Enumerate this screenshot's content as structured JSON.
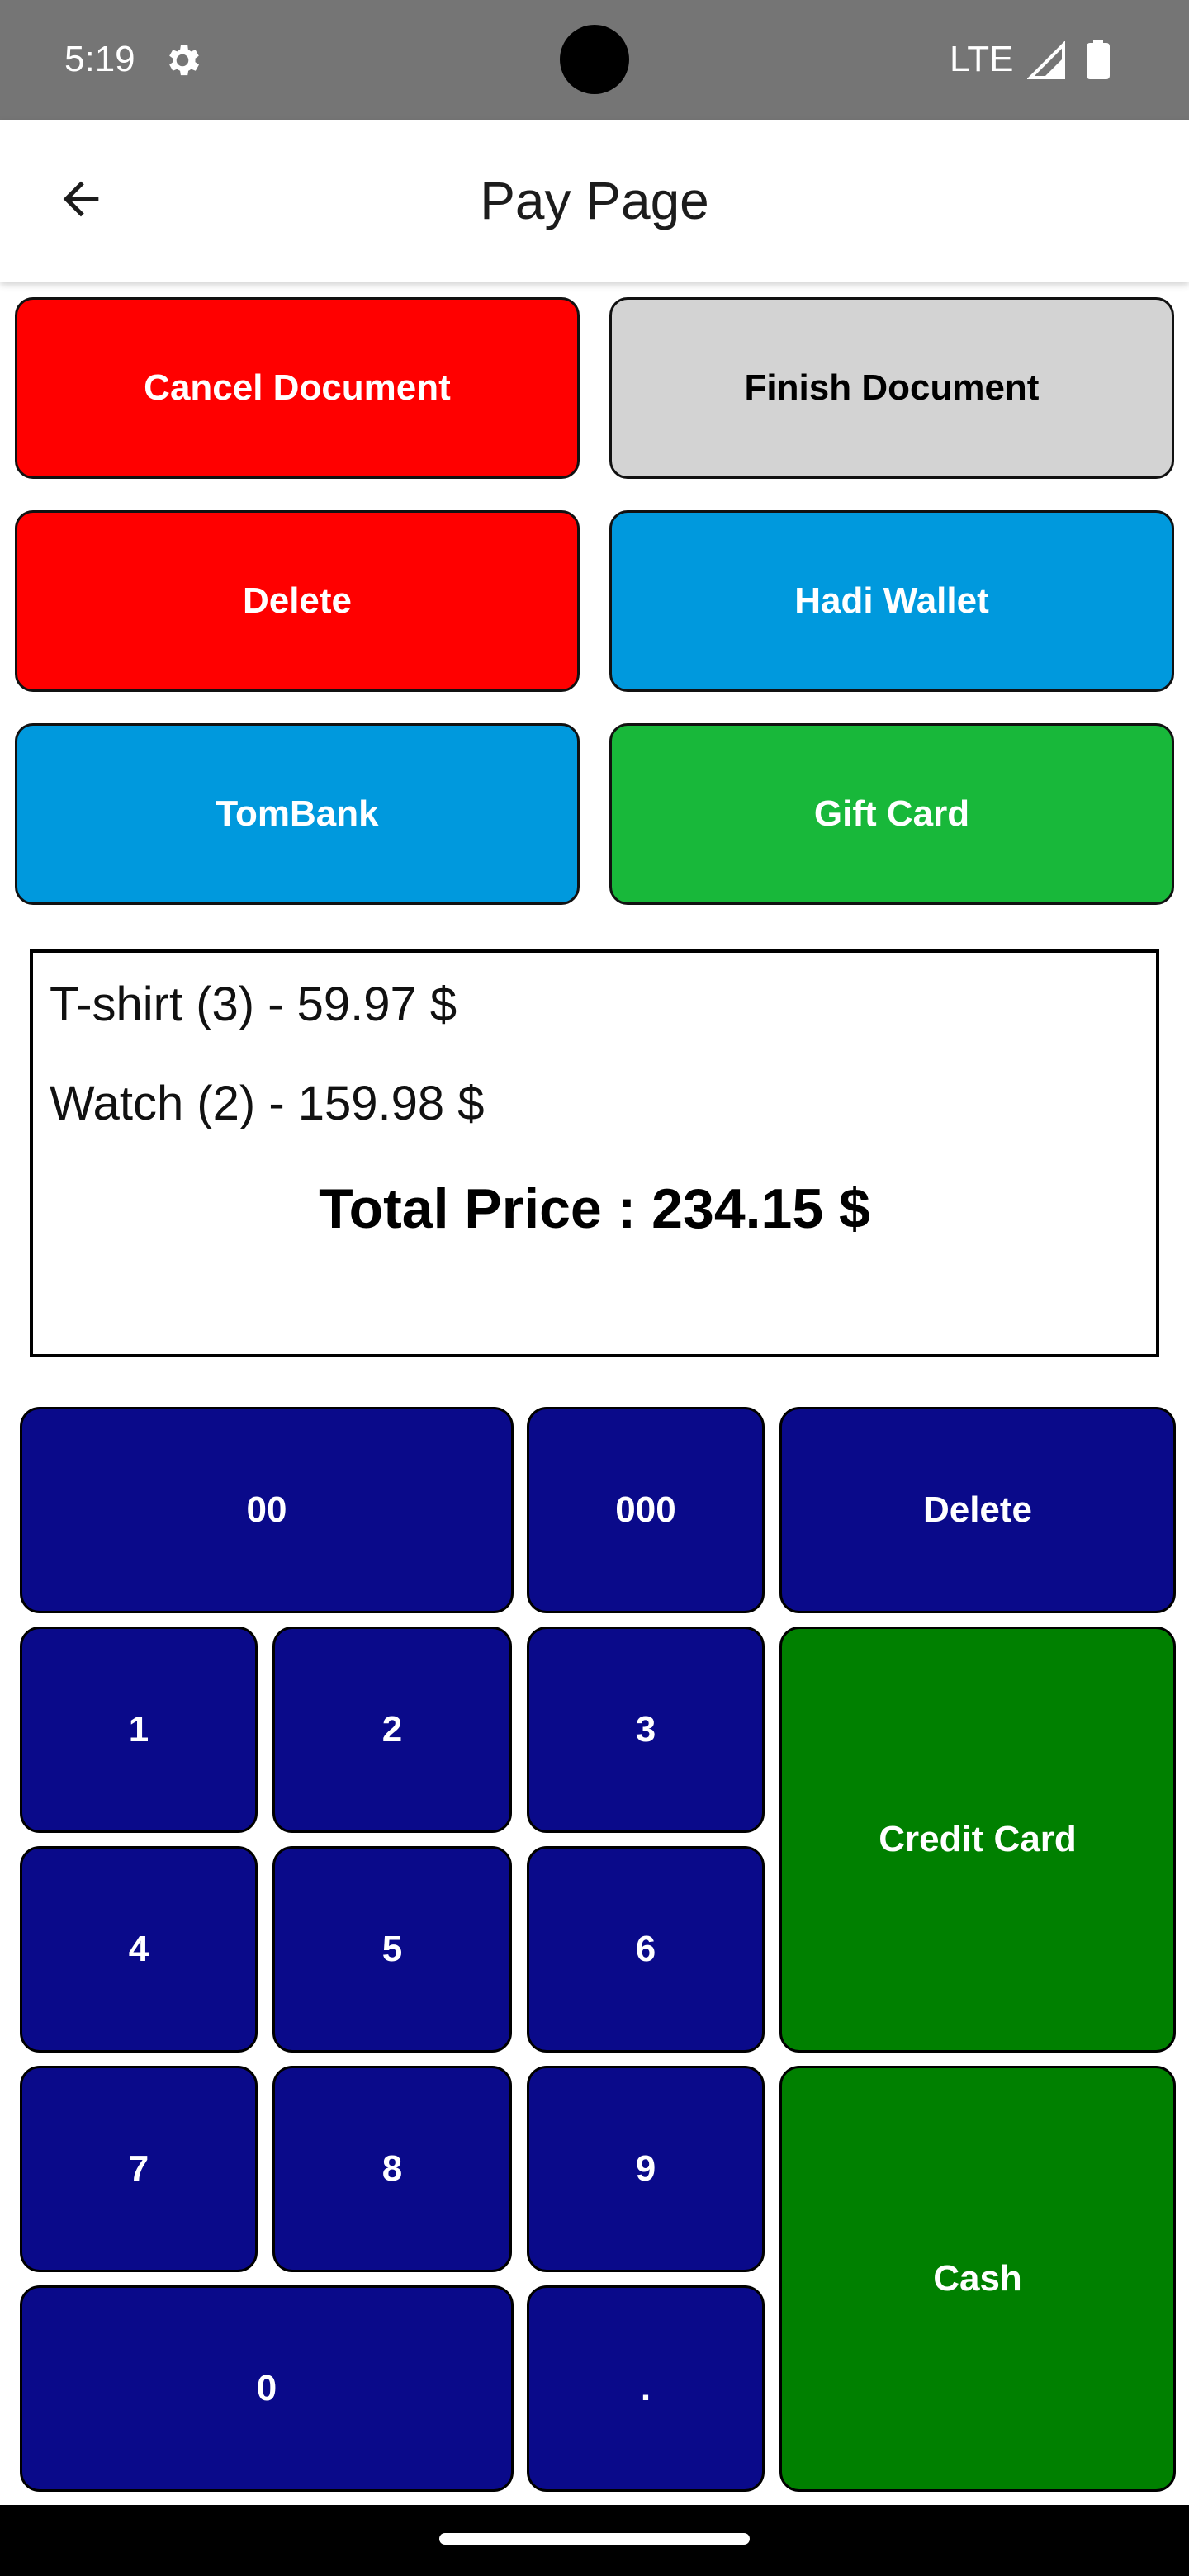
{
  "status_bar": {
    "time": "5:19",
    "network": "LTE",
    "icons": [
      "settings-gear-icon",
      "signal-icon",
      "battery-icon"
    ]
  },
  "app_bar": {
    "title": "Pay Page",
    "back_icon": "arrow-left-icon"
  },
  "actions": {
    "cancel_document": "Cancel Document",
    "finish_document": "Finish Document",
    "delete": "Delete",
    "hadi_wallet": "Hadi Wallet",
    "tombank": "TomBank",
    "gift_card": "Gift Card"
  },
  "receipt": {
    "items": [
      {
        "text": "T-shirt (3) - 59.97 $"
      },
      {
        "text": "Watch (2) - 159.98 $"
      }
    ],
    "total": "Total Price : 234.15 $"
  },
  "keypad": {
    "k00": "00",
    "k000": "000",
    "delete": "Delete",
    "k1": "1",
    "k2": "2",
    "k3": "3",
    "k4": "4",
    "k5": "5",
    "k6": "6",
    "k7": "7",
    "k8": "8",
    "k9": "9",
    "k0": "0",
    "dot": ".",
    "credit_card": "Credit Card",
    "cash": "Cash"
  },
  "colors": {
    "red": "#ff0000",
    "gray": "#d3d3d3",
    "blue": "#0099dd",
    "green_light": "#18b83a",
    "navy": "#0a0a8a",
    "green_dark": "#008000",
    "status_bar": "#757575"
  }
}
